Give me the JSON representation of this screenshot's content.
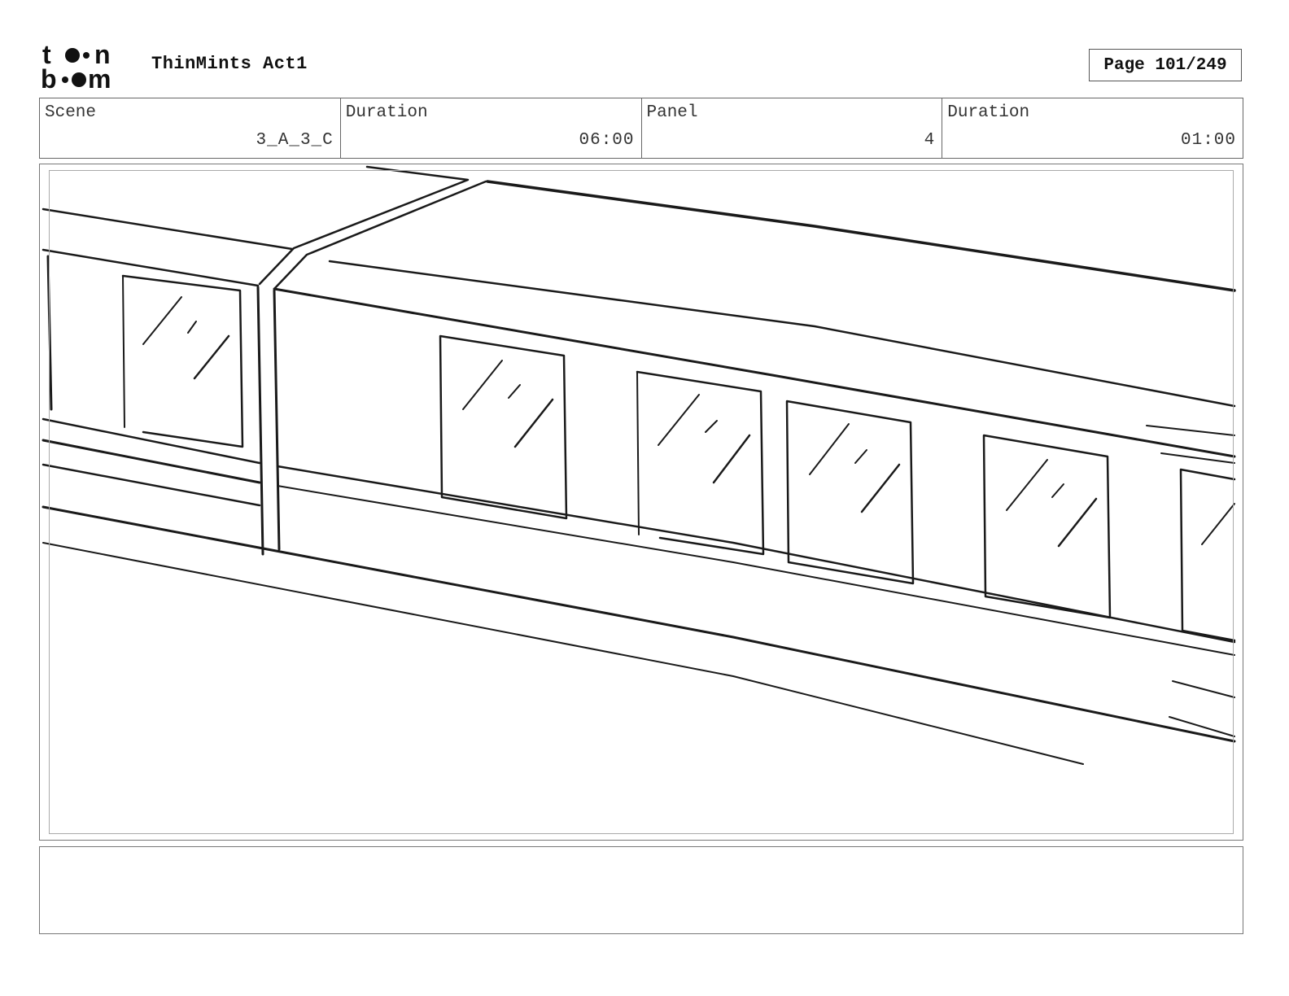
{
  "header": {
    "logo_line1": "toon",
    "logo_line2": "boom",
    "project_title": "ThinMints Act1",
    "page_indicator": "Page 101/249"
  },
  "info": {
    "scene_label": "Scene",
    "scene_value": "3_A_3_C",
    "scene_duration_label": "Duration",
    "scene_duration_value": "06:00",
    "panel_label": "Panel",
    "panel_value": "4",
    "panel_duration_label": "Duration",
    "panel_duration_value": "01:00"
  },
  "notes": {
    "text": ""
  }
}
